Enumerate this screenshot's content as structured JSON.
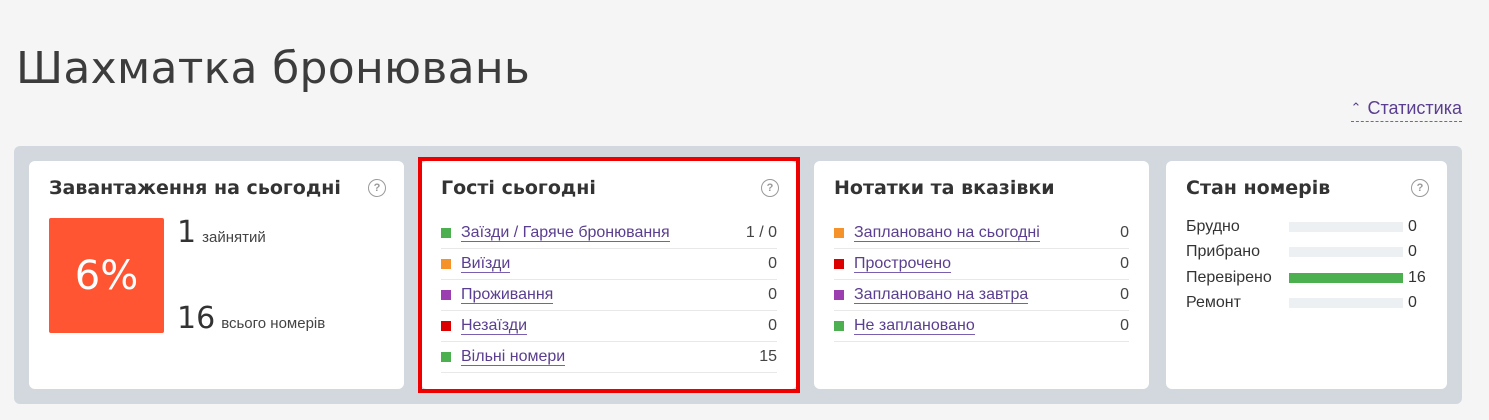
{
  "page": {
    "title": "Шахматка бронювань",
    "stats_toggle": "Статистика"
  },
  "occupancy": {
    "title": "Завантаження на сьогодні",
    "percent": "6%",
    "occupied_count": "1",
    "occupied_label": "зайнятий",
    "total_count": "16",
    "total_label": "всього номерів",
    "accent_color": "#ff5533"
  },
  "guests_today": {
    "title": "Гості сьогодні",
    "rows": [
      {
        "label": "Заїзди / Гаряче бронювання",
        "value": "1 / 0",
        "color": "#4caf50"
      },
      {
        "label": "Виїзди",
        "value": "0",
        "color": "#f5922a"
      },
      {
        "label": "Проживання",
        "value": "0",
        "color": "#9b3fb0"
      },
      {
        "label": "Незаїзди",
        "value": "0",
        "color": "#dd0000"
      },
      {
        "label": "Вільні номери",
        "value": "15",
        "color": "#4caf50"
      }
    ]
  },
  "notes": {
    "title": "Нотатки та вказівки",
    "rows": [
      {
        "label": "Заплановано на сьогодні",
        "value": "0",
        "color": "#f5922a"
      },
      {
        "label": "Прострочено",
        "value": "0",
        "color": "#dd0000"
      },
      {
        "label": "Заплановано на завтра",
        "value": "0",
        "color": "#9b3fb0"
      },
      {
        "label": "Не заплановано",
        "value": "0",
        "color": "#4caf50"
      }
    ]
  },
  "room_status": {
    "title": "Стан номерів",
    "rows": [
      {
        "label": "Брудно",
        "value": "0",
        "fraction": 0,
        "color": "#4caf50"
      },
      {
        "label": "Прибрано",
        "value": "0",
        "fraction": 0,
        "color": "#4caf50"
      },
      {
        "label": "Перевірено",
        "value": "16",
        "fraction": 1,
        "color": "#4caf50"
      },
      {
        "label": "Ремонт",
        "value": "0",
        "fraction": 0,
        "color": "#4caf50"
      }
    ]
  }
}
